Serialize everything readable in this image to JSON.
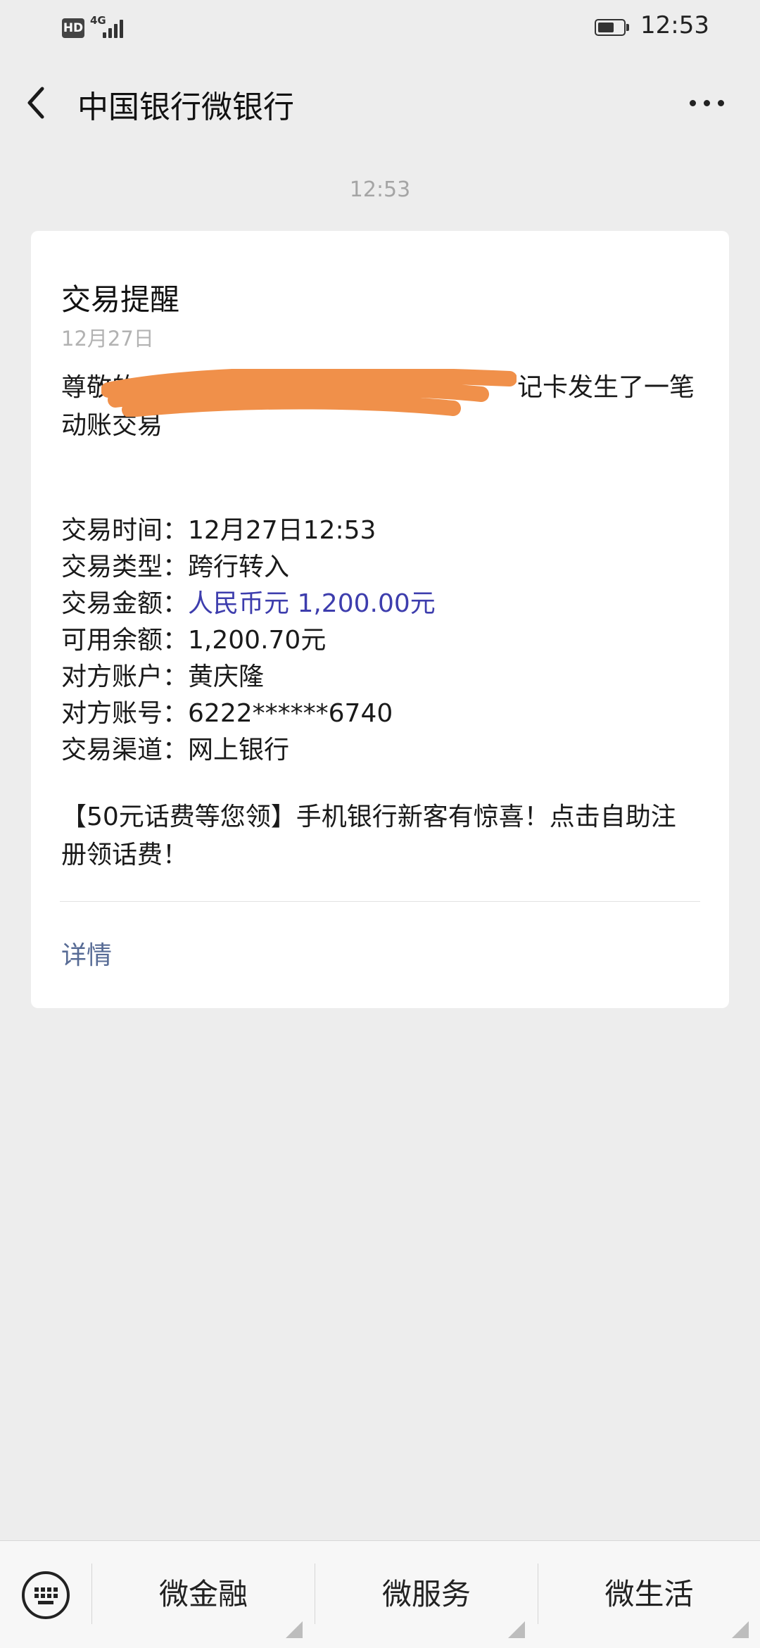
{
  "status_bar": {
    "hd": "HD",
    "network": "4G",
    "time": "12:53",
    "battery_level": 0.5
  },
  "nav": {
    "title": "中国银行微银行"
  },
  "chat": {
    "timestamp": "12:53"
  },
  "card": {
    "title": "交易提醒",
    "date": "12月27日",
    "greeting": "尊敬的　　　　　　　　　　　　　　　记卡发生了一笔动账交易",
    "fields": [
      {
        "label": "交易时间：",
        "value": "12月27日12:53"
      },
      {
        "label": "交易类型：",
        "value": "跨行转入"
      },
      {
        "label": "交易金额：",
        "value": "人民币元 1,200.00元"
      },
      {
        "label": "可用余额：",
        "value": "1,200.70元"
      },
      {
        "label": "对方账户：",
        "value": "黄庆隆"
      },
      {
        "label": "对方账号：",
        "value": "6222******6740"
      },
      {
        "label": "交易渠道：",
        "value": "网上银行"
      }
    ],
    "promo": "【50元话费等您领】手机银行新客有惊喜！点击自助注册领话费！",
    "details_label": "详情"
  },
  "colors": {
    "amount": "#3d3dad",
    "link": "#576b95",
    "redaction": "#f0904a"
  },
  "bottom_menu": [
    {
      "label": "微金融"
    },
    {
      "label": "微服务"
    },
    {
      "label": "微生活"
    }
  ],
  "icons": {
    "back": "chevron-left-icon",
    "more": "more-dots-icon",
    "keyboard": "keyboard-icon"
  }
}
